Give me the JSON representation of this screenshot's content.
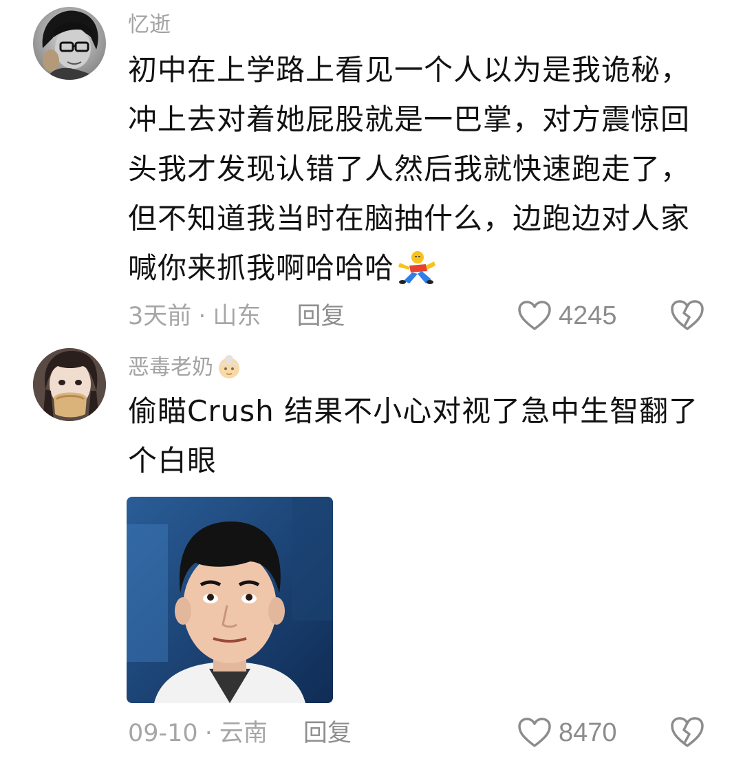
{
  "comments": [
    {
      "username": "忆逝",
      "avatar_icon": "avatar-man-with-glasses",
      "lines": [
        "初中在上学路上看见一个人以为是我诡秘，",
        "冲上去对着她屁股就是一巴掌，对方震惊回",
        "头我才发现认错了人然后我就快速跑走了，",
        "但不知道我当时在脑抽什么，边跑边对人家",
        "喊你来抓我啊哈哈哈"
      ],
      "inline_emoji": "fallen-person-emoji",
      "time": "3天前",
      "separator": "·",
      "location": "山东",
      "reply_label": "回复",
      "like_count": "4245"
    },
    {
      "username": "恶毒老奶",
      "username_badge": "grandma-emoji",
      "avatar_icon": "avatar-girl-eating-bread",
      "lines": [
        "偷瞄Crush 结果不小心对视了急中生智翻了",
        "个白眼"
      ],
      "image": "man-eye-roll-photo",
      "time": "09-10",
      "separator": "·",
      "location": "云南",
      "reply_label": "回复",
      "like_count": "8470"
    }
  ],
  "colors": {
    "background": "#ffffff",
    "text": "#121212",
    "secondary": "#a6a6a6",
    "icon": "#8c8c8c"
  }
}
